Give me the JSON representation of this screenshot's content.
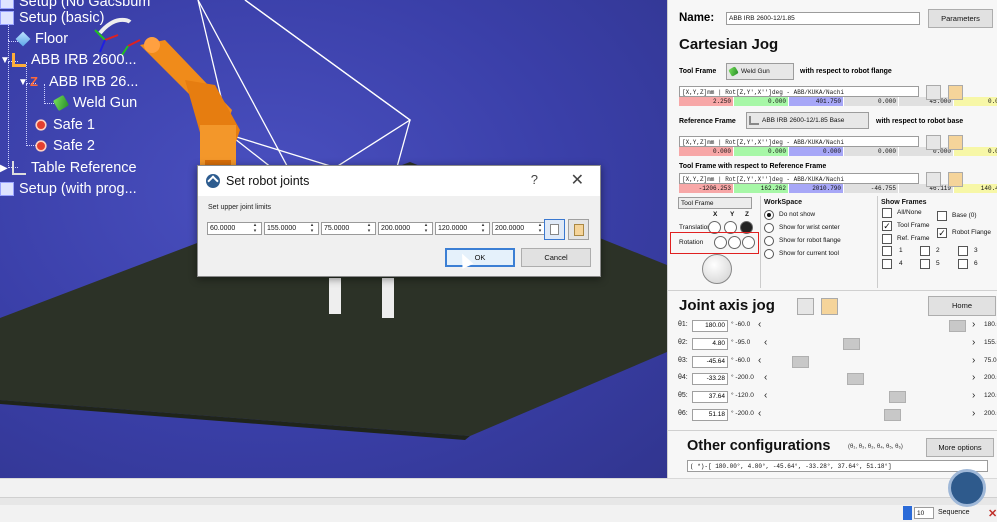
{
  "tree": {
    "items": [
      {
        "label": "Setup (No Gacsbum",
        "icon": "document-icon"
      },
      {
        "label": "Setup (basic)",
        "icon": "document-icon"
      },
      {
        "label": "Floor",
        "icon": "cube-icon"
      },
      {
        "label": "ABB IRB 2600...",
        "icon": "robot-icon"
      },
      {
        "label": "ABB IRB 26...",
        "icon": "robot-arm-icon"
      },
      {
        "label": "Weld Gun",
        "icon": "weld-gun-icon"
      },
      {
        "label": "Safe 1",
        "icon": "target-icon"
      },
      {
        "label": "Safe 2",
        "icon": "target-icon"
      },
      {
        "label": "Table Reference",
        "icon": "frame-icon"
      },
      {
        "label": "Setup (with prog...",
        "icon": "document-icon"
      }
    ]
  },
  "dialog": {
    "title": "Set robot joints",
    "help": "?",
    "close": "✕",
    "label": "Set upper joint limits",
    "limits": [
      "60.0000",
      "155.0000",
      "75.0000",
      "200.0000",
      "120.0000",
      "200.0000"
    ],
    "ok": "OK",
    "cancel": "Cancel"
  },
  "panel": {
    "name_label": "Name:",
    "name_value": "ABB IRB 2600-12/1.85",
    "parameters": "Parameters",
    "cartesian_jog": "Cartesian Jog",
    "tool_frame_label": "Tool Frame",
    "tool_frame_value": "Weld Gun",
    "tool_frame_suffix": "with respect to robot flange",
    "tool_format": "[X,Y,Z]mm | Rot[Z,Y',X'']deg - ABB/KUKA/Nachi",
    "tool_values": [
      "2.250",
      "0.000",
      "401.750",
      "0.000",
      "45.000",
      "0.000"
    ],
    "ref_frame_label": "Reference Frame",
    "ref_frame_value": "ABB IRB 2600-12/1.85 Base",
    "ref_frame_suffix": "with respect to robot base",
    "ref_format": "[X,Y,Z]mm | Rot[Z,Y',X'']deg - ABB/KUKA/Nachi",
    "ref_values": [
      "0.000",
      "0.000",
      "0.000",
      "0.000",
      "0.000",
      "0.000"
    ],
    "tool_ref_label": "Tool Frame with respect to Reference Frame",
    "tool_ref_format": "[X,Y,Z]mm | Rot[Z,Y',X'']deg - ABB/KUKA/Nachi",
    "tool_ref_values": [
      "-1206.253",
      "162.262",
      "2010.790",
      "-46.755",
      "46.119",
      "140.477"
    ],
    "jog_frame": "Tool Frame",
    "axes": [
      "X",
      "Y",
      "Z"
    ],
    "translation": "Translation",
    "rotation": "Rotation",
    "workspace": {
      "title": "WorkSpace",
      "options": [
        "Do not show",
        "Show for wrist center",
        "Show for robot flange",
        "Show for current tool"
      ]
    },
    "show_frames": {
      "title": "Show Frames",
      "all_none": "All/None",
      "tool_frame": "Tool Frame",
      "ref_frame": "Ref. Frame",
      "base": "Base (0)",
      "robot_flange": "Robot Flange",
      "nums": [
        "1",
        "2",
        "3",
        "4",
        "5",
        "6"
      ]
    },
    "joint_jog": "Joint axis jog",
    "home": "Home",
    "joints": [
      {
        "name": "θ1:",
        "value": "180.00",
        "min": "° -60.0",
        "max": "180.0",
        "pos": 1.0
      },
      {
        "name": "θ2:",
        "value": "4.80",
        "min": "° -95.0",
        "max": "155.0",
        "pos": 0.4
      },
      {
        "name": "θ3:",
        "value": "-45.64",
        "min": "° -60.0",
        "max": "75.0",
        "pos": 0.11
      },
      {
        "name": "θ4:",
        "value": "-33.28",
        "min": "° -200.0",
        "max": "200.0",
        "pos": 0.42
      },
      {
        "name": "θ5:",
        "value": "37.64",
        "min": "° -120.0",
        "max": "120.0",
        "pos": 0.66
      },
      {
        "name": "θ6:",
        "value": "51.18",
        "min": "° -200.0",
        "max": "200.0",
        "pos": 0.63
      }
    ],
    "other_configs": "Other configurations",
    "other_configs_sub": "(θ₁, θ₃, θ₃, θ₄, θ₅, θ₆)",
    "more_options": "More options",
    "config_values": "( *)-[ 180.00°,    4.80°,   -45.64°,   -33.28°,   37.64°,   51.18°]"
  },
  "bottom": {
    "sequence_count": "10",
    "sequence_label": "Sequence"
  },
  "colors": {
    "x_axis": "#f7a7a7",
    "y_axis": "#a7f7a7",
    "z_axis": "#a7a7f7",
    "rx": "#e0e0e0",
    "ry": "#e0e0e0",
    "rz": "#f7f7a7",
    "highlight_box": "#e02020"
  }
}
